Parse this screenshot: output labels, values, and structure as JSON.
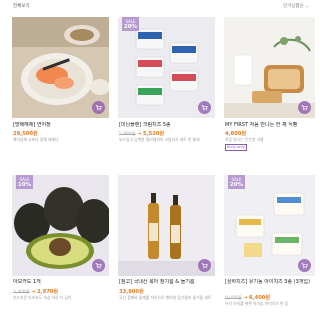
{
  "header": {
    "section_label": "전체보기",
    "sort_label": "인기상품순 ⌄"
  },
  "products": [
    {
      "name": "[망배해제] 연어정",
      "price": "29,500원",
      "orig_price": "",
      "discount_arrow": "",
      "sale_pct": "",
      "desc": "해석섬해 고포다 함해 레해다",
      "tag": "",
      "image_icon": "salmon-rice-bowl-photo"
    },
    {
      "name": "[미닝플랜] 크림치즈 5종",
      "price": "5,520원",
      "orig_price": "5,980원",
      "discount_arrow": "→",
      "sale_pct": "20%",
      "desc": "부드럽고 담백한 필라델피아 크림치즈 세트 한 통에",
      "tag": "",
      "image_icon": "cream-cheese-cups-photo"
    },
    {
      "name": "MY FIRST 처음 만나는 한 채 식빵",
      "price": "4,800원",
      "orig_price": "",
      "discount_arrow": "",
      "sale_pct": "",
      "desc": "처음 만나는 든든한 식빵",
      "tag": "Kurly only",
      "image_icon": "bread-loaf-photo"
    },
    {
      "name": "아보카도 1개",
      "price": "2,970원",
      "orig_price": "3,300원",
      "discount_arrow": "→",
      "sale_pct": "10%",
      "desc": "부드러운 아보카도 숙성 하루 더 담아",
      "tag": "",
      "image_icon": "avocado-photo"
    },
    {
      "name": "[참고] 국내산 볶아 참기름 & 들기름",
      "price": "33,800원",
      "orig_price": "",
      "discount_arrow": "",
      "sale_pct": "",
      "desc": "국산 참깨와 들깨를 저온으로 볶아낸 참기름과 들기름 세트",
      "tag": "",
      "image_icon": "sesame-oil-bottles-photo"
    },
    {
      "name": "[상하치즈] 유기농 아이치즈 3종 (3개입)",
      "price": "6,400원",
      "orig_price": "8,000원",
      "discount_arrow": "→",
      "sale_pct": "20%",
      "desc": "우리 아이를 위한 유기농 아이치즈 한 장",
      "tag": "",
      "image_icon": "organic-kids-cheese-photo"
    }
  ],
  "sale_badge_word": "SALE",
  "colors": {
    "accent": "#8d5bad",
    "badge": "#b79bd0",
    "price": "#e67e22"
  }
}
